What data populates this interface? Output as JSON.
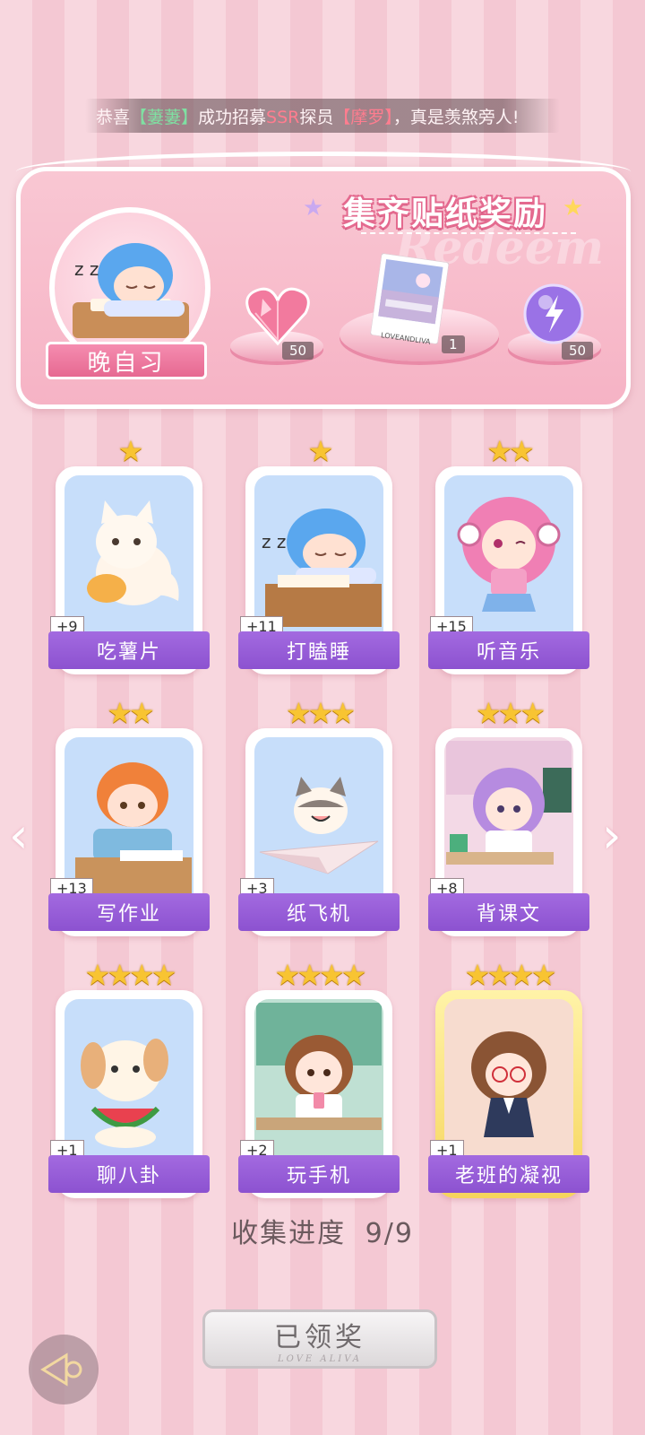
{
  "ticker": {
    "prefix": "恭喜",
    "name1": "【萋萋】",
    "mid": "成功招募",
    "rank": "SSR",
    "mid2": "探员",
    "name2": "【摩罗】",
    "suffix": "，真是羡煞旁人!"
  },
  "banner": {
    "title": "集齐贴纸奖励",
    "watermark": "Redeem",
    "badge_label": "晚自习",
    "rewards": [
      {
        "icon": "heart-gem-icon",
        "count": "50"
      },
      {
        "icon": "photo-card-icon",
        "count": "1",
        "caption": "LOVEANDLIVA"
      },
      {
        "icon": "lightning-orb-icon",
        "count": "50"
      }
    ]
  },
  "stickers": [
    {
      "name": "吃薯片",
      "count": "+9",
      "stars": 1
    },
    {
      "name": "打瞌睡",
      "count": "+11",
      "stars": 1
    },
    {
      "name": "听音乐",
      "count": "+15",
      "stars": 2
    },
    {
      "name": "写作业",
      "count": "+13",
      "stars": 2
    },
    {
      "name": "纸飞机",
      "count": "+3",
      "stars": 3
    },
    {
      "name": "背课文",
      "count": "+8",
      "stars": 3
    },
    {
      "name": "聊八卦",
      "count": "+1",
      "stars": 4
    },
    {
      "name": "玩手机",
      "count": "+2",
      "stars": 4
    },
    {
      "name": "老班的凝视",
      "count": "+1",
      "stars": 4
    }
  ],
  "progress": {
    "label": "收集进度",
    "value": "9/9"
  },
  "claim_button": {
    "label": "已领奖",
    "sub": "LOVE ALIVA"
  },
  "colors": {
    "accent_purple": "#9b62da",
    "pink_bg": "#f8d7df",
    "star_gold": "#f8c432"
  }
}
